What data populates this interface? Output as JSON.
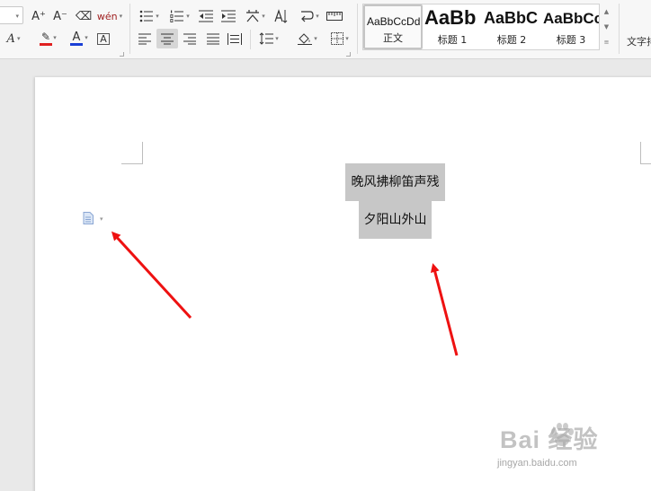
{
  "toolbar": {
    "row1": {
      "grow_font": "A⁺",
      "shrink_font": "A⁻",
      "clear_format": "⌫",
      "phonetic": "wén"
    },
    "row2": {
      "text_effect": "A",
      "highlight": "✎",
      "font_color": "A",
      "char_border": "A"
    },
    "style_gallery": {
      "items": [
        {
          "preview": "AaBbCcDd",
          "name": "正文",
          "active": true
        },
        {
          "preview": "AaBb",
          "name": "标题 1",
          "active": false
        },
        {
          "preview": "AaBbC",
          "name": "标题 2",
          "active": false
        },
        {
          "preview": "AaBbCc",
          "name": "标题 3",
          "active": false
        }
      ]
    },
    "text_tools_label": "文字排"
  },
  "colors": {
    "font_color_bar": "#1a3fd6",
    "highlight_bar": "#e02020",
    "arrow": "#ee1111",
    "selection": "#c7c7c7"
  },
  "document": {
    "lines": [
      "晚风拂柳笛声残",
      "夕阳山外山"
    ]
  },
  "watermark": {
    "brand": "Bai 经验",
    "url": "jingyan.baidu.com"
  }
}
